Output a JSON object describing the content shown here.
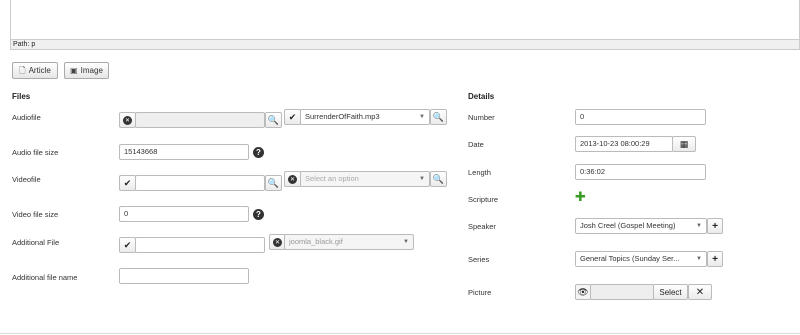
{
  "editor": {
    "path_label": "Path:",
    "path_value": "p"
  },
  "toolbar": {
    "article_label": "Article",
    "image_label": "Image"
  },
  "files": {
    "heading": "Files",
    "audiofile": {
      "label": "Audiofile",
      "value": "",
      "select_value": "SurrenderOfFaith.mp3"
    },
    "audio_size": {
      "label": "Audio file size",
      "value": "15143668"
    },
    "videofile": {
      "label": "Videofile",
      "value": "",
      "select_placeholder": "Select an option"
    },
    "video_size": {
      "label": "Video file size",
      "value": "0"
    },
    "additional_file": {
      "label": "Additional File",
      "value": "",
      "select_value": "joomla_black.gif"
    },
    "additional_name": {
      "label": "Additional file name",
      "value": ""
    }
  },
  "details": {
    "heading": "Details",
    "number": {
      "label": "Number",
      "value": "0"
    },
    "date": {
      "label": "Date",
      "value": "2013-10-23 08:00:29"
    },
    "length": {
      "label": "Length",
      "value": "0:36:02"
    },
    "scripture": {
      "label": "Scripture"
    },
    "speaker": {
      "label": "Speaker",
      "value": "Josh Creel (Gospel Meeting)"
    },
    "series": {
      "label": "Series",
      "value": "General Topics (Sunday Ser..."
    },
    "picture": {
      "label": "Picture",
      "value": "",
      "select_label": "Select"
    }
  },
  "colors": {
    "accent_green": "#3a9d23",
    "dark_icon": "#333333"
  },
  "icons": [
    "document-icon",
    "image-icon",
    "clear-icon",
    "search-icon",
    "check-icon",
    "help-icon",
    "calendar-icon",
    "plus-icon",
    "eye-icon",
    "close-icon",
    "chevron-down-icon"
  ]
}
